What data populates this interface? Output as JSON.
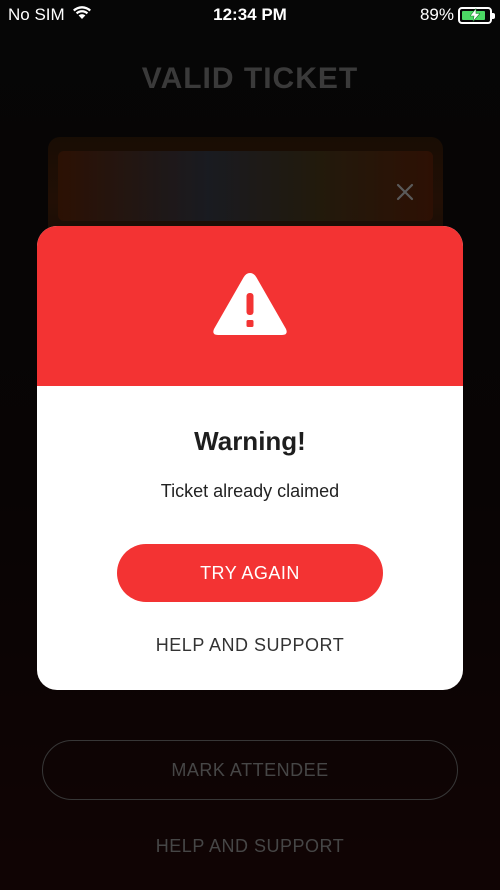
{
  "status_bar": {
    "carrier": "No SIM",
    "time": "12:34 PM",
    "battery": "89%",
    "battery_level": 0.89,
    "icons": [
      "wifi-icon",
      "battery-charging-icon"
    ]
  },
  "background": {
    "title": "VALID TICKET",
    "mark_attendee_label": "MARK ATTENDEE",
    "help_label": "HELP AND SUPPORT",
    "close_icon": "close-icon"
  },
  "modal": {
    "icon": "warning-triangle-icon",
    "title": "Warning!",
    "message": "Ticket already claimed",
    "primary_label": "TRY AGAIN",
    "secondary_label": "HELP AND SUPPORT"
  },
  "colors": {
    "accent": "#f33333",
    "battery": "#4cd964"
  }
}
